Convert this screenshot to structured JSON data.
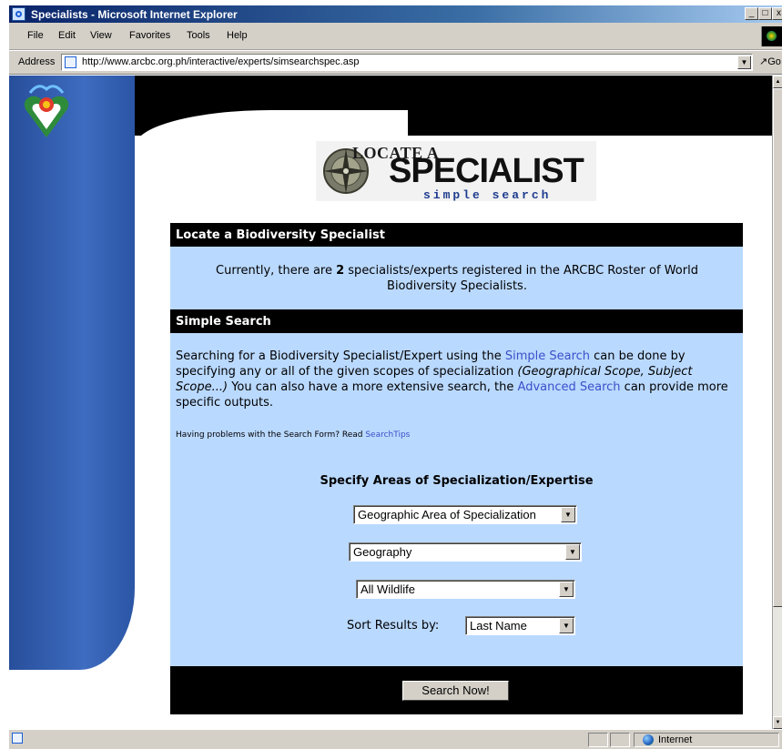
{
  "window": {
    "title": "Specialists - Microsoft Internet Explorer",
    "controls": [
      "_",
      "□",
      "x"
    ]
  },
  "menu": [
    "File",
    "Edit",
    "View",
    "Favorites",
    "Tools",
    "Help"
  ],
  "address": {
    "label": "Address",
    "url": "http://www.arcbc.org.ph/interactive/experts/simsearchspec.asp",
    "go_label": "Go"
  },
  "banner": {
    "line1": "LOCATE A",
    "line2": "SPECIALIST",
    "line3": "simple search"
  },
  "section1": {
    "title": "Locate a Biodiversity Specialist",
    "text_pre": "Currently, there are ",
    "count": "2",
    "text_post": " specialists/experts registered in the ARCBC Roster of World Biodiversity Specialists."
  },
  "section2": {
    "title": "Simple Search",
    "p1": "Searching for a Biodiversity Specialist/Expert using the ",
    "link_simple": "Simple Search",
    "p2": " can be done by specifying any or all of the given scopes of specialization ",
    "scopes": "(Geographical Scope, Subject Scope...)",
    "p3": " You can also have a more extensive search, the ",
    "link_advanced": "Advanced Search",
    "p4": " can provide more specific outputs.",
    "tips_pre": "Having problems with the Search Form? Read ",
    "tips_link": "SearchTips"
  },
  "form": {
    "heading": "Specify Areas of Specialization/Expertise",
    "area_select": "Geographic Area of Specialization",
    "geo_select": "Geography",
    "wildlife_select": "All Wildlife",
    "sort_label": "Sort Results by:",
    "sort_select": "Last Name",
    "search_button": "Search Now!"
  },
  "status": {
    "zone": "Internet"
  },
  "colors": {
    "content_bg": "#bad9ff",
    "header_bg": "#000000",
    "link": "#3b50c9",
    "left_panel": "#3e6cc0"
  },
  "icons": [
    "ie-page-icon",
    "windows-flag-icon",
    "compass-icon",
    "site-logo-icon",
    "globe-icon",
    "dropdown-arrow-icon"
  ]
}
